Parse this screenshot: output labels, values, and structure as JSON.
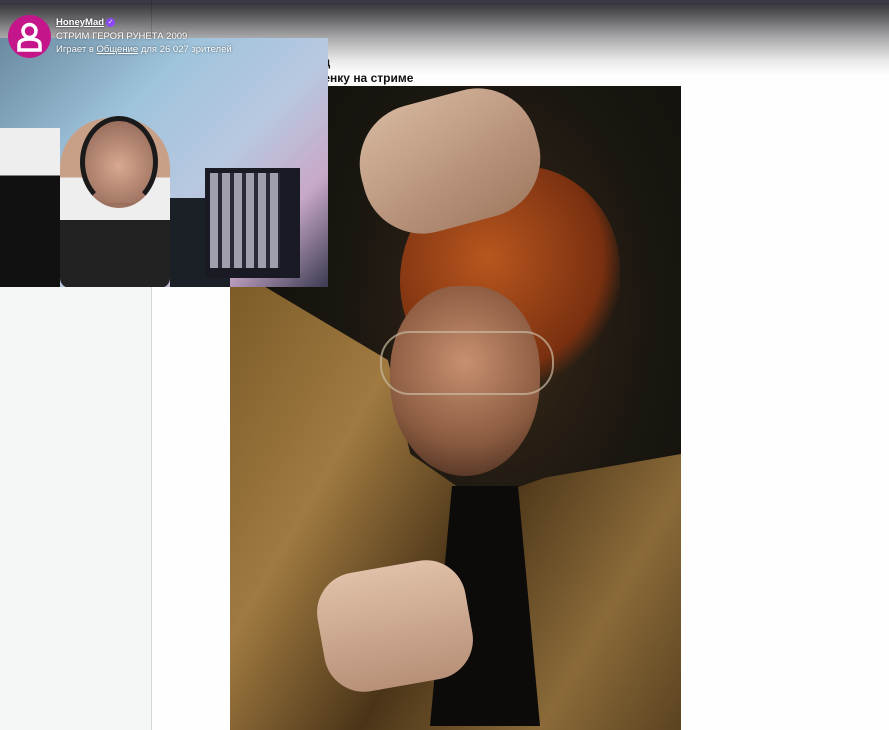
{
  "stream": {
    "channel_name": "HoneyMad",
    "verified_icon": "verified-badge-icon",
    "title": "СТРИМ ГЕРОЯ РУНЕТА 2009",
    "playing_prefix": "Играет в",
    "category": "Общение",
    "viewers_text": "для 26 027 зрителей",
    "avatar_color": "#c5158a"
  },
  "post": {
    "title_line1": "ед",
    "title_line2": "ценку на стриме"
  }
}
